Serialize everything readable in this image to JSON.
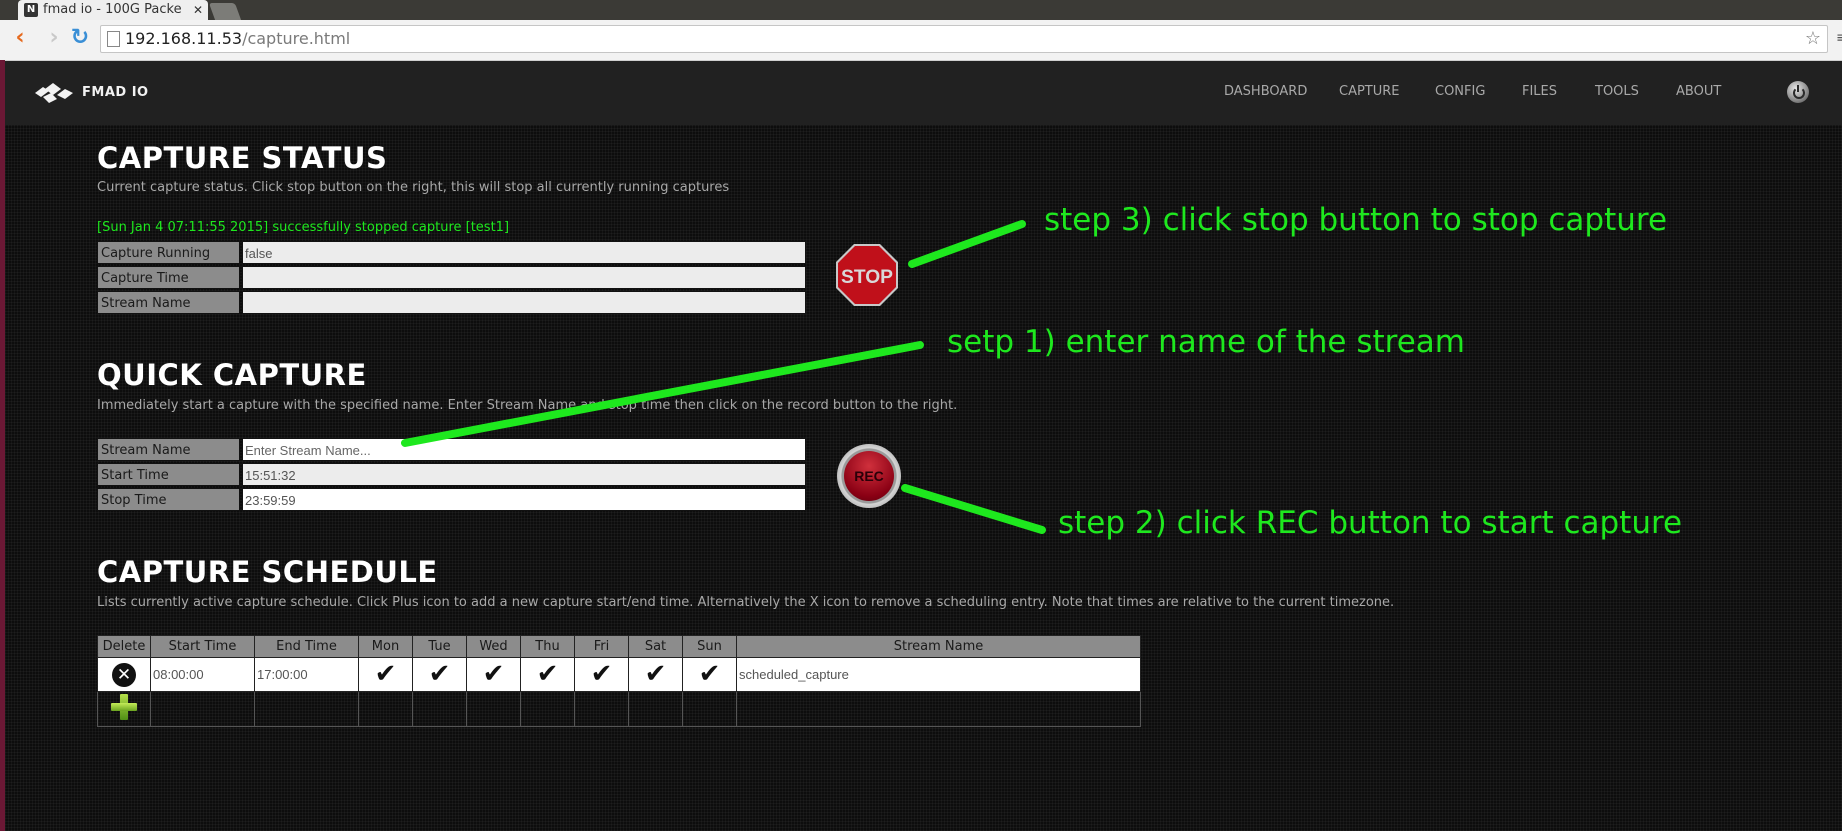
{
  "browser": {
    "tab_favicon": "N",
    "tab_title": "fmad io - 100G Packe",
    "url_host": "192.168.11.53",
    "url_path": "/capture.html"
  },
  "navbar": {
    "logo_text": "FMAD IO",
    "items": [
      "DASHBOARD",
      "CAPTURE",
      "CONFIG",
      "FILES",
      "TOOLS",
      "ABOUT"
    ],
    "power_icon": "power-icon"
  },
  "capture_status": {
    "title": "CAPTURE STATUS",
    "description": "Current capture status. Click stop button on the right, this will stop all currently running captures",
    "message": "[Sun Jan 4 07:11:55 2015] successfully stopped capture [test1]",
    "rows": [
      {
        "label": "Capture Running",
        "value": "false"
      },
      {
        "label": "Capture Time",
        "value": ""
      },
      {
        "label": "Stream Name",
        "value": ""
      }
    ],
    "stop_label": "STOP"
  },
  "quick_capture": {
    "title": "QUICK CAPTURE",
    "description": "Immediately start a capture with the specified name. Enter Stream Name and stop time then click on the record button to the right.",
    "stream_name_label": "Stream Name",
    "stream_name_value": "",
    "stream_name_placeholder": "Enter Stream Name...",
    "start_time_label": "Start Time",
    "start_time_value": "15:51:32",
    "stop_time_label": "Stop Time",
    "stop_time_value": "23:59:59",
    "rec_label": "REC"
  },
  "capture_schedule": {
    "title": "CAPTURE SCHEDULE",
    "description": "Lists currently active capture schedule. Click Plus icon to add a new capture start/end time. Alternatively the X icon to remove a scheduling entry. Note that times are relative to the current timezone.",
    "columns": [
      "Delete",
      "Start Time",
      "End Time",
      "Mon",
      "Tue",
      "Wed",
      "Thu",
      "Fri",
      "Sat",
      "Sun",
      "Stream Name"
    ],
    "rows": [
      {
        "start_time": "08:00:00",
        "end_time": "17:00:00",
        "days": {
          "Mon": true,
          "Tue": true,
          "Wed": true,
          "Thu": true,
          "Fri": true,
          "Sat": true,
          "Sun": true
        },
        "stream_name": "scheduled_capture"
      }
    ],
    "check_glyph": "✔",
    "delete_glyph": "✕"
  },
  "annotations": {
    "step1": "setp 1) enter name of the stream",
    "step2": "step 2) click REC button to start capture",
    "step3": "step 3) click stop button to stop capture",
    "color": "#1ee81e"
  }
}
